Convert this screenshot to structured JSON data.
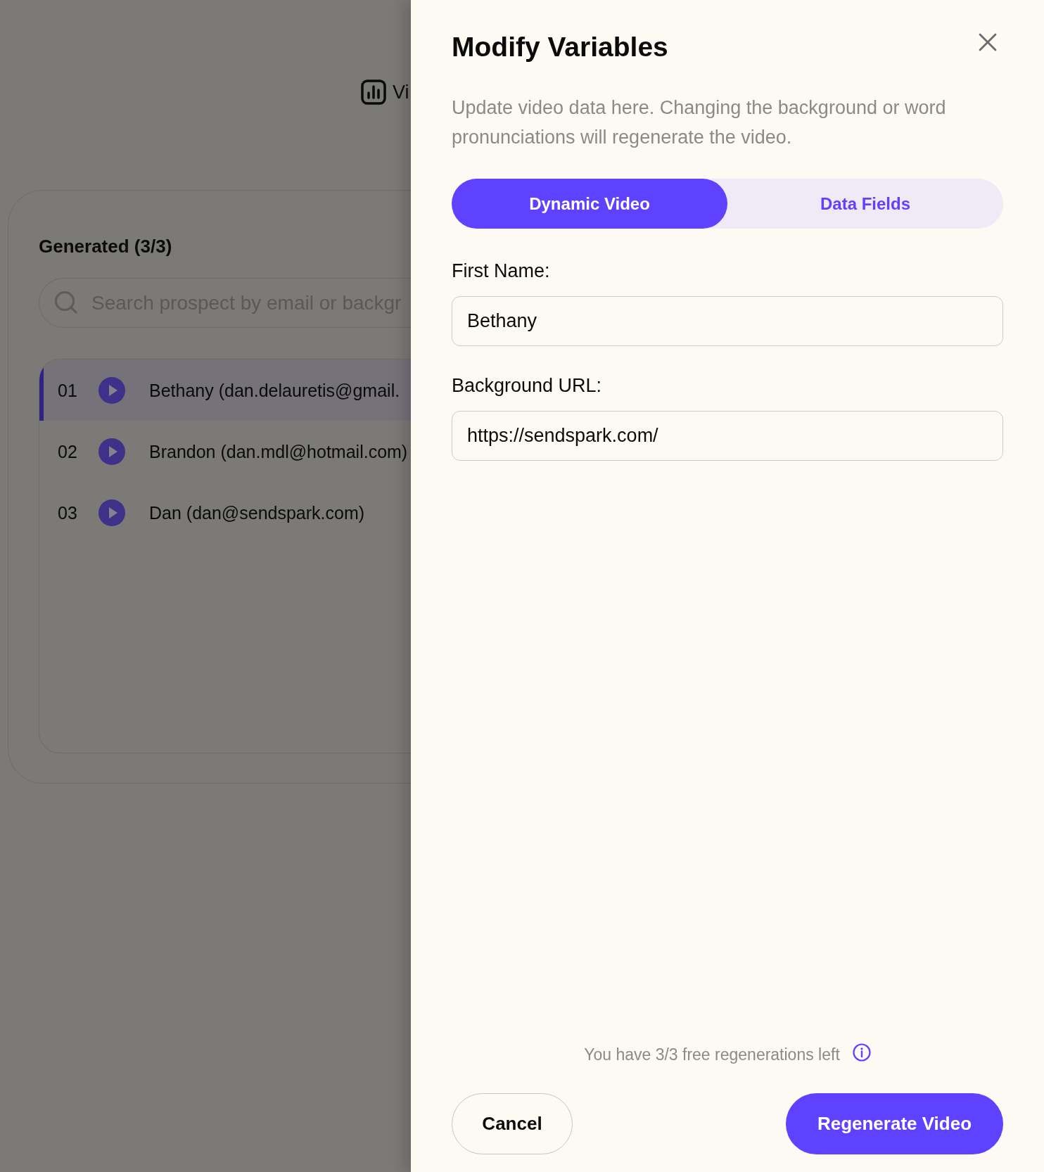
{
  "background_page": {
    "toolbar": {
      "label": "Vi"
    },
    "generated": {
      "title": "Generated (3/3)",
      "search": {
        "placeholder": "Search prospect by email or backgr"
      },
      "rows": [
        {
          "number": "01",
          "name": "Bethany (dan.delauretis@gmail.",
          "selected": true
        },
        {
          "number": "02",
          "name": "Brandon (dan.mdl@hotmail.com)",
          "selected": false
        },
        {
          "number": "03",
          "name": "Dan (dan@sendspark.com)",
          "selected": false
        }
      ]
    }
  },
  "panel": {
    "title": "Modify Variables",
    "description": "Update video data here. Changing the background or word pronunciations will regenerate the video.",
    "tabs": [
      {
        "label": "Dynamic Video",
        "selected": true
      },
      {
        "label": "Data Fields",
        "selected": false
      }
    ],
    "fields": [
      {
        "label": "First Name:",
        "value": "Bethany"
      },
      {
        "label": "Background URL:",
        "value": "https://sendspark.com/"
      }
    ],
    "footer_note": "You have 3/3 free regenerations left",
    "buttons": [
      {
        "label": "Cancel",
        "kind": "secondary"
      },
      {
        "label": "Regenerate Video",
        "kind": "primary"
      }
    ]
  }
}
